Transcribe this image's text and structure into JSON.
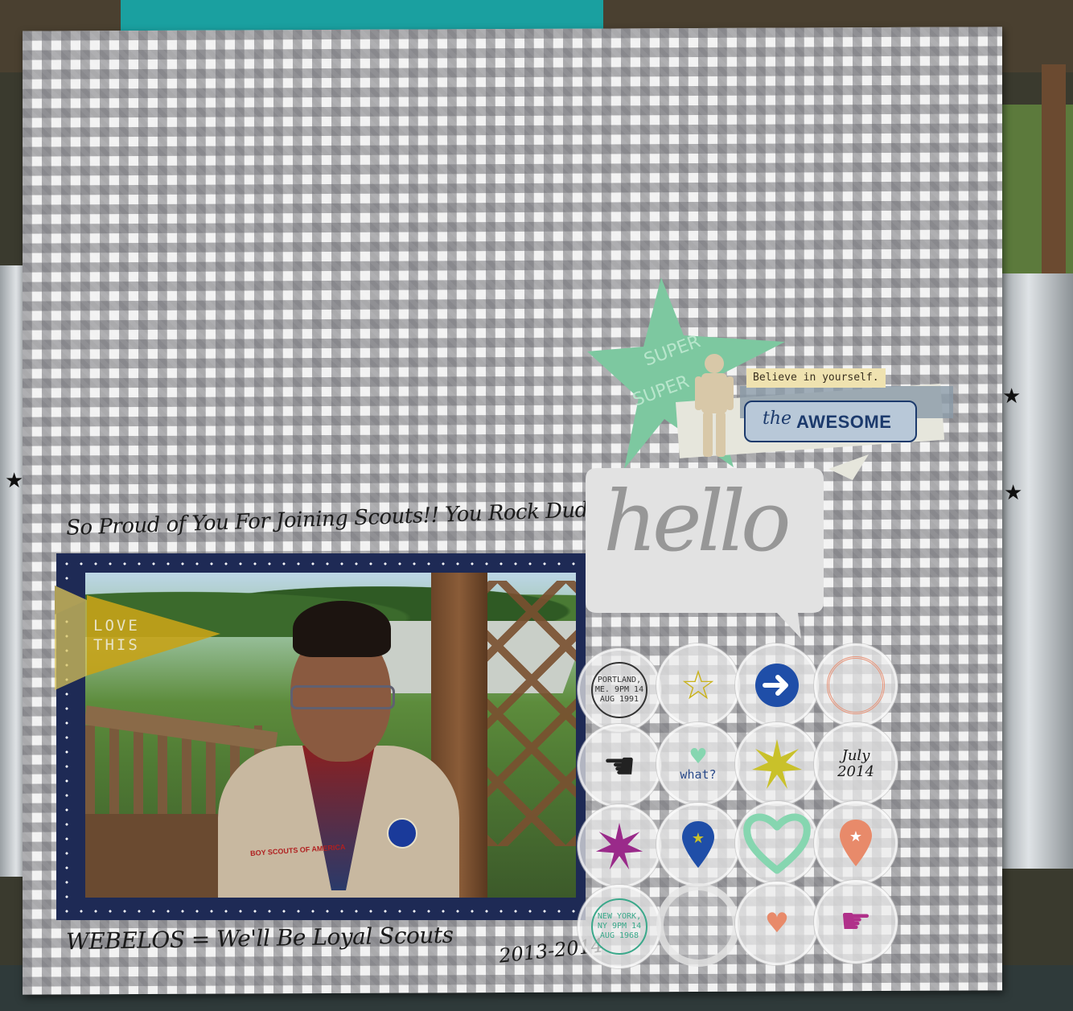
{
  "captions": {
    "top": "So Proud of You For Joining Scouts!! You Rock Dude!!",
    "bottom": "WEBELOS = We'll Be Loyal Scouts",
    "year": "2013-2014"
  },
  "banner": {
    "line1": "LOVE",
    "line2": "THIS"
  },
  "embellishments": {
    "star_text": "SUPER",
    "believe": "Believe in yourself.",
    "awesome_script": "the",
    "awesome_bold": "AWESOME",
    "hello": "hello"
  },
  "circles": {
    "stamp1": "PORTLAND, ME. 9PM 14 AUG 1991",
    "what": "what?",
    "date_line1": "July",
    "date_line2": "2014",
    "stamp2": "NEW YORK, NY 9PM 14 AUG 1968"
  },
  "photo": {
    "patch_text": "BOY SCOUTS OF AMERICA"
  },
  "colors": {
    "mat_navy": "#1e2a55",
    "banner_mustard": "#c7a318",
    "star_green": "#7dc8a0",
    "heart_mint": "#86d6b0",
    "arrow_blue": "#1f4ea8",
    "burst_yellow": "#c9c12a",
    "burst_magenta": "#9a2a8a",
    "pin_orange": "#e88a6a",
    "hand_magenta": "#b0308a"
  }
}
